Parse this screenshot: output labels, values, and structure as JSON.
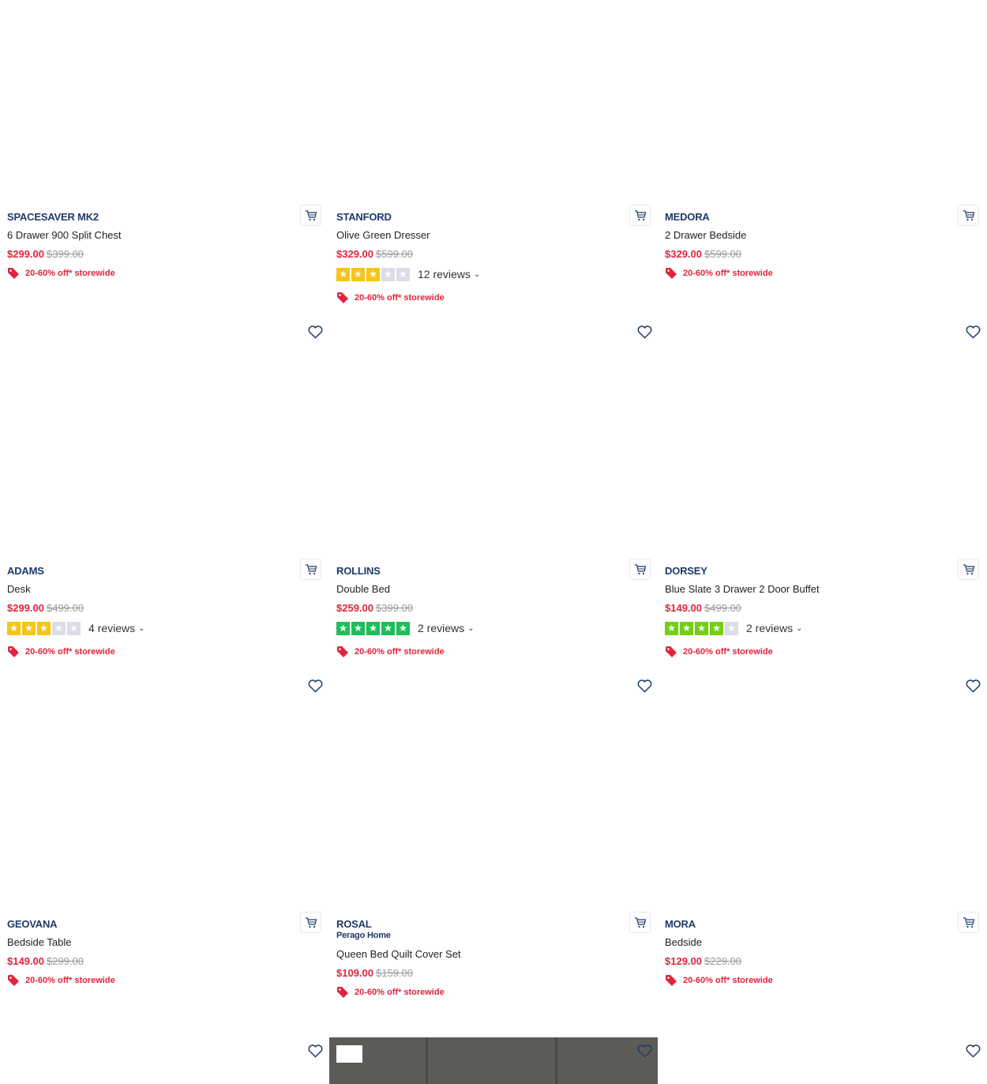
{
  "colors": {
    "brand": "#1f3a67",
    "price": "#e0243c",
    "was_price": "#9a9a9a",
    "star_yellow": "#f5c518",
    "star_green": "#1dbf5a",
    "star_lightgreen": "#73cf11"
  },
  "products": [
    {
      "brand": "SPACESAVER MK2",
      "name": "6 Drawer 900 Split Chest",
      "price": "$299.00",
      "was": "$399.00",
      "promo": "20-60% off* storewide"
    },
    {
      "brand": "STANFORD",
      "name": "Olive Green Dresser",
      "price": "$329.00",
      "was": "$599.00",
      "rating": 3,
      "reviews": "12 reviews",
      "promo": "20-60% off* storewide"
    },
    {
      "brand": "MEDORA",
      "name": "2 Drawer Bedside",
      "price": "$329.00",
      "was": "$599.00",
      "promo": "20-60% off* storewide"
    },
    {
      "brand": "ADAMS",
      "name": "Desk",
      "price": "$299.00",
      "was": "$499.00",
      "rating": 3,
      "reviews": "4 reviews",
      "promo": "20-60% off* storewide"
    },
    {
      "brand": "ROLLINS",
      "name": "Double Bed",
      "price": "$259.00",
      "was": "$399.00",
      "rating": 5,
      "reviews": "2 reviews",
      "promo": "20-60% off* storewide"
    },
    {
      "brand": "DORSEY",
      "name": "Blue Slate 3 Drawer 2 Door Buffet",
      "price": "$149.00",
      "was": "$499.00",
      "rating": 4,
      "reviews": "2 reviews",
      "promo": "20-60% off* storewide"
    },
    {
      "brand": "GEOVANA",
      "name": "Bedside Table",
      "price": "$149.00",
      "was": "$299.00",
      "promo": "20-60% off* storewide"
    },
    {
      "brand": "ROSAL",
      "subbrand": "Perago Home",
      "name": "Queen Bed Quilt Cover Set",
      "price": "$109.00",
      "was": "$159.00",
      "promo": "20-60% off* storewide"
    },
    {
      "brand": "MORA",
      "name": "Bedside",
      "price": "$129.00",
      "was": "$229.00",
      "promo": "20-60% off* storewide"
    }
  ],
  "icons": {
    "cart": "cart-icon",
    "wishlist": "heart-icon",
    "promo": "tag-icon",
    "chevron": "chevron-down-icon"
  }
}
